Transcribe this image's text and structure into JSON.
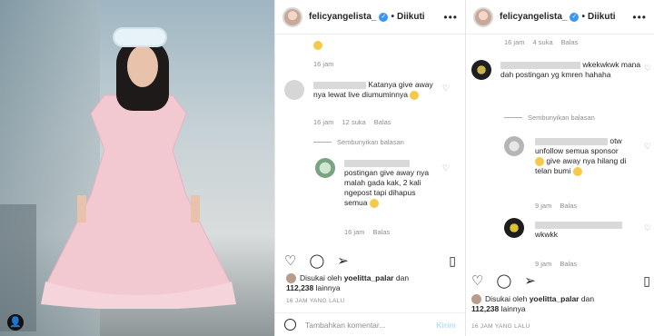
{
  "header": {
    "username": "felicyangelista_",
    "verified_icon": "verified-badge-icon",
    "follow_sep": "•",
    "follow_label": "Diikuti",
    "more": "•••"
  },
  "panel1": {
    "c0_time": "16 jam",
    "c1_text": "Katanya give away nya lewat live diumuminnya",
    "c1_time": "16 jam",
    "c1_likes": "12 suka",
    "c1_reply": "Balas",
    "hide_label": "Sembunyikan balasan",
    "c2_text": "postingan give away nya malah gada kak, 2 kali ngepost tapi dihapus semua",
    "c2_time": "16 jam",
    "c2_reply": "Balas",
    "liked_by_prefix": "Disukai oleh",
    "liked_by_user": "yoelitta_palar",
    "liked_by_and": "dan",
    "liked_count": "112,238",
    "liked_suffix": "lainnya",
    "post_time": "16 JAM YANG LALU",
    "add_comment_placeholder": "Tambahkan komentar...",
    "send_label": "Kirim"
  },
  "panel2": {
    "top_time": "16 jam",
    "top_likes": "4 suka",
    "top_reply": "Balas",
    "c1_text_tail": "wkekwkwk mana dah postingan yg kmren hahaha",
    "hide_label": "Sembunyikan balasan",
    "c2_text_tail": "otw unfollow semua sponsor",
    "c2_text_2": "give away nya hilang di telan bumi",
    "c2_time": "9 jam",
    "c2_reply": "Balas",
    "c3_text": "wkwkk",
    "c3_time": "9 jam",
    "c3_reply": "Balas",
    "liked_by_prefix": "Disukai oleh",
    "liked_by_user": "yoelitta_palar",
    "liked_by_and": "dan",
    "liked_count": "112,238",
    "liked_suffix": "lainnya",
    "post_time": "16 JAM YANG LALU"
  },
  "icons": {
    "heart": "heart-icon",
    "comment": "comment-icon",
    "share": "share-icon",
    "bookmark": "bookmark-icon",
    "smile": "emoji-icon"
  },
  "colors": {
    "verified": "#3897f0",
    "muted": "#8e8e8e",
    "send": "#b2dffc"
  }
}
